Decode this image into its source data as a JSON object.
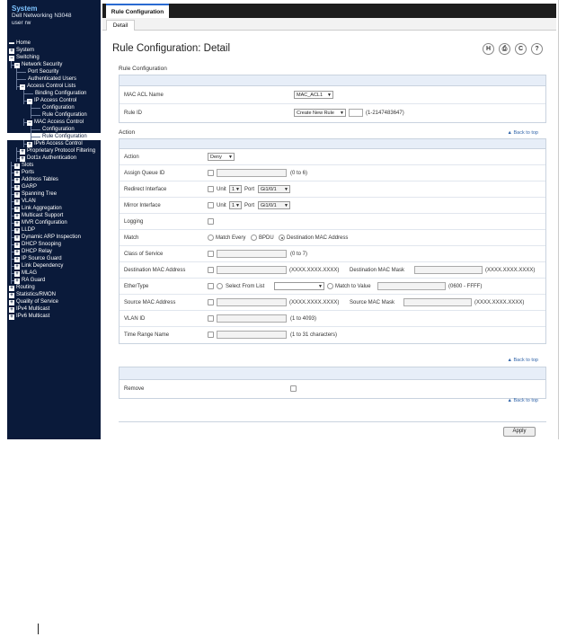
{
  "sidebar": {
    "system_title": "System",
    "device": "Dell Networking N3048",
    "user": "user rw",
    "nav": [
      {
        "label": "Home",
        "level": 0,
        "box": "",
        "icon": "home"
      },
      {
        "label": "System",
        "level": 0,
        "box": "+"
      },
      {
        "label": "Switching",
        "level": 0,
        "box": "−"
      },
      {
        "label": "Network Security",
        "level": 1,
        "box": "−"
      },
      {
        "label": "Port Security",
        "level": 2,
        "box": ""
      },
      {
        "label": "Authenticated Users",
        "level": 2,
        "box": ""
      },
      {
        "label": "Access Control Lists",
        "level": 2,
        "box": "−"
      },
      {
        "label": "Binding Configuration",
        "level": 3,
        "box": ""
      },
      {
        "label": "IP Access Control",
        "level": 3,
        "box": "−"
      },
      {
        "label": "Configuration",
        "level": 4,
        "box": ""
      },
      {
        "label": "Rule Configuration",
        "level": 4,
        "box": ""
      },
      {
        "label": "MAC Access Control",
        "level": 3,
        "box": "−"
      },
      {
        "label": "Configuration",
        "level": 4,
        "box": ""
      },
      {
        "label": "Rule Configuration",
        "level": 4,
        "box": "",
        "active": true
      },
      {
        "label": "IPv6 Access Control",
        "level": 3,
        "box": "+"
      },
      {
        "label": "Proprietary Protocol Filtering",
        "level": 2,
        "box": "+"
      },
      {
        "label": "Dot1x Authentication",
        "level": 2,
        "box": "+"
      },
      {
        "label": "Slots",
        "level": 1,
        "box": "+"
      },
      {
        "label": "Ports",
        "level": 1,
        "box": "+"
      },
      {
        "label": "Address Tables",
        "level": 1,
        "box": "+"
      },
      {
        "label": "GARP",
        "level": 1,
        "box": "+"
      },
      {
        "label": "Spanning Tree",
        "level": 1,
        "box": "+"
      },
      {
        "label": "VLAN",
        "level": 1,
        "box": "+"
      },
      {
        "label": "Link Aggregation",
        "level": 1,
        "box": "+"
      },
      {
        "label": "Multicast Support",
        "level": 1,
        "box": "+"
      },
      {
        "label": "MVR Configuration",
        "level": 1,
        "box": "+"
      },
      {
        "label": "LLDP",
        "level": 1,
        "box": "+"
      },
      {
        "label": "Dynamic ARP Inspection",
        "level": 1,
        "box": "+"
      },
      {
        "label": "DHCP Snooping",
        "level": 1,
        "box": "+"
      },
      {
        "label": "DHCP Relay",
        "level": 1,
        "box": "+"
      },
      {
        "label": "IP Source Guard",
        "level": 1,
        "box": "+"
      },
      {
        "label": "Link Dependency",
        "level": 1,
        "box": "+"
      },
      {
        "label": "MLAG",
        "level": 1,
        "box": "+"
      },
      {
        "label": "RA Guard",
        "level": 1,
        "box": "+"
      },
      {
        "label": "Routing",
        "level": 0,
        "box": "+"
      },
      {
        "label": "Statistics/RMON",
        "level": 0,
        "box": "+"
      },
      {
        "label": "Quality of Service",
        "level": 0,
        "box": "+"
      },
      {
        "label": "IPv4 Multicast",
        "level": 0,
        "box": "+"
      },
      {
        "label": "IPv6 Multicast",
        "level": 0,
        "box": "+"
      }
    ]
  },
  "tabs": {
    "main": "Rule Configuration",
    "sub": "Detail"
  },
  "page": {
    "title": "Rule Configuration: Detail",
    "toolbar_icons": [
      "save-icon",
      "print-icon",
      "refresh-icon",
      "help-icon"
    ],
    "toolbar_glyphs": {
      "save": "H",
      "print": "⎙",
      "refresh": "C",
      "help": "?"
    }
  },
  "rule_config": {
    "section": "Rule Configuration",
    "mac_acl_name_label": "MAC ACL Name",
    "mac_acl_name_value": "MAC_ACL1",
    "rule_id_label": "Rule ID",
    "rule_id_select": "Create New Rule",
    "rule_id_range": "(1-2147483647)"
  },
  "action_section": {
    "title": "Action",
    "back_to_top": "▲ Back to top",
    "action_label": "Action",
    "action_value": "Deny",
    "assign_queue_label": "Assign Queue ID",
    "assign_queue_hint": "(0 to 6)",
    "redirect_label": "Redirect Interface",
    "mirror_label": "Mirror Interface",
    "unit_label": "Unit",
    "unit_value": "1",
    "port_label": "Port",
    "port_value": "Gi1/0/1",
    "logging_label": "Logging",
    "match_label": "Match",
    "match_every": "Match Every",
    "bpdu": "BPDU",
    "dest_mac_opt": "Destination MAC Address",
    "cos_label": "Class of Service",
    "cos_hint": "(0 to 7)",
    "dest_mac_label": "Destination MAC Address",
    "mac_fmt": "(XXXX.XXXX.XXXX)",
    "dest_mac_mask_label": "Destination MAC Mask",
    "ethertype_label": "EtherType",
    "select_from_list": "Select From List",
    "match_to_value": "Match to Value",
    "ethertype_range": "(0600 - FFFF)",
    "src_mac_label": "Source MAC Address",
    "src_mac_mask_label": "Source MAC Mask",
    "vlan_label": "VLAN ID",
    "vlan_hint": "(1 to 4093)",
    "time_range_label": "Time Range Name",
    "time_range_hint": "(1 to 31 characters)"
  },
  "remove_section": {
    "back_to_top": "▲ Back to top",
    "remove_label": "Remove",
    "back_to_top_2": "▲ Back to top"
  },
  "apply_label": "Apply"
}
